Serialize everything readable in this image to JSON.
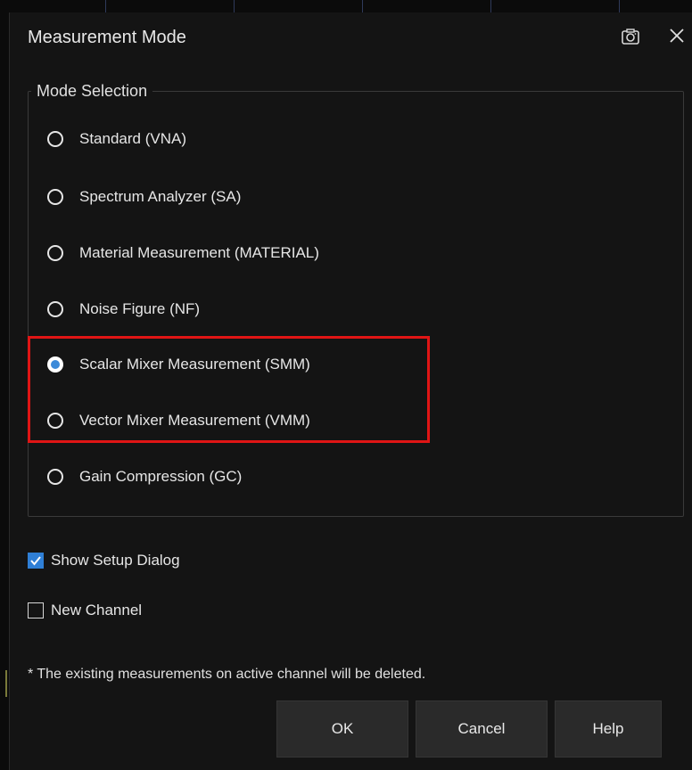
{
  "dialog": {
    "title": "Measurement Mode",
    "icons": {
      "screenshot": "camera-icon",
      "close": "close-icon"
    }
  },
  "mode_selection": {
    "legend": "Mode Selection",
    "options": [
      {
        "label": "Standard  (VNA)",
        "selected": false
      },
      {
        "label": "Spectrum Analyzer  (SA)",
        "selected": false
      },
      {
        "label": "Material Measurement  (MATERIAL)",
        "selected": false
      },
      {
        "label": "Noise Figure  (NF)",
        "selected": false
      },
      {
        "label": "Scalar Mixer Measurement  (SMM)",
        "selected": true
      },
      {
        "label": "Vector Mixer Measurement  (VMM)",
        "selected": false
      },
      {
        "label": "Gain Compression  (GC)",
        "selected": false
      }
    ]
  },
  "options": {
    "show_setup_dialog": {
      "label": "Show Setup Dialog",
      "checked": true
    },
    "new_channel": {
      "label": "New Channel",
      "checked": false
    }
  },
  "note": "* The existing measurements on active channel will be deleted.",
  "buttons": {
    "ok": "OK",
    "cancel": "Cancel",
    "help": "Help"
  },
  "colors": {
    "accent": "#3c8ad9",
    "highlight": "#e01515",
    "background": "#141414"
  }
}
